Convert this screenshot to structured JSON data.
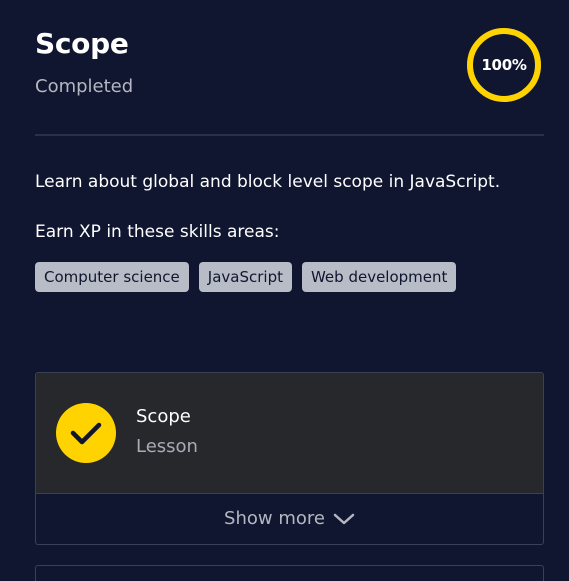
{
  "header": {
    "title": "Scope",
    "status": "Completed",
    "progress_text": "100%",
    "progress_value": 1.0
  },
  "description": "Learn about global and block level scope in JavaScript.",
  "skills": {
    "heading": "Earn XP in these skills areas:",
    "tags": [
      "Computer science",
      "JavaScript",
      "Web development"
    ]
  },
  "lesson_card": {
    "title": "Scope",
    "type": "Lesson",
    "show_more_label": "Show more",
    "icon": "check-icon"
  },
  "colors": {
    "background": "#10162f",
    "accent": "#ffd300",
    "chip_background": "#b8bcc6",
    "card_background": "#26282b"
  }
}
